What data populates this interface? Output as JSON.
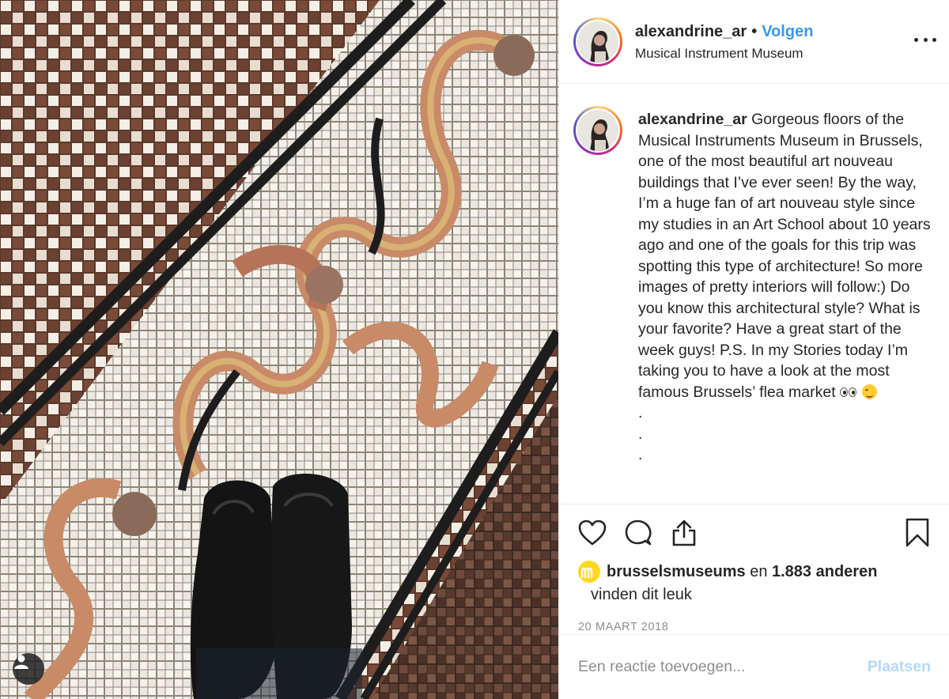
{
  "photo": {
    "alt_icon": "user-tag-icon"
  },
  "header": {
    "username": "alexandrine_ar",
    "separator": "•",
    "follow_label": "Volgen",
    "location": "Musical Instrument Museum",
    "more_icon": "more-options-icon"
  },
  "caption": {
    "username": "alexandrine_ar",
    "text": "Gorgeous floors of the Musical Instruments Museum in Brussels, one of the most beautiful art nouveau buildings that I’ve ever seen! By the way, I’m a huge fan of art nouveau style since my studies in an Art School about 10 years ago and one of the goals for this trip was spotting this type of architecture! So more images of pretty interiors will follow:) Do you know this architectural style? What is your favorite? Have a great start of the week guys! P.S. In my Stories today I’m taking you to have a look at the most famous Brussels’ flea market",
    "emoji_1": "eyes-emoji",
    "emoji_2": "winking-face-emoji",
    "dots": [
      ".",
      ".",
      "."
    ]
  },
  "actions": {
    "like_icon": "heart-icon",
    "comment_icon": "comment-icon",
    "share_icon": "share-icon",
    "save_icon": "bookmark-icon"
  },
  "likes": {
    "liker": "brusselsmuseums",
    "connector": " en ",
    "others": "1.883 anderen",
    "suffix": "vinden dit leuk"
  },
  "date": "20 MAART 2018",
  "comment_box": {
    "placeholder": "Een reactie toevoegen...",
    "post_label": "Plaatsen"
  },
  "colors": {
    "link_blue": "#3897f0",
    "post_disabled": "#b3d9fb",
    "muted": "#8e8e8e",
    "text": "#262626"
  }
}
